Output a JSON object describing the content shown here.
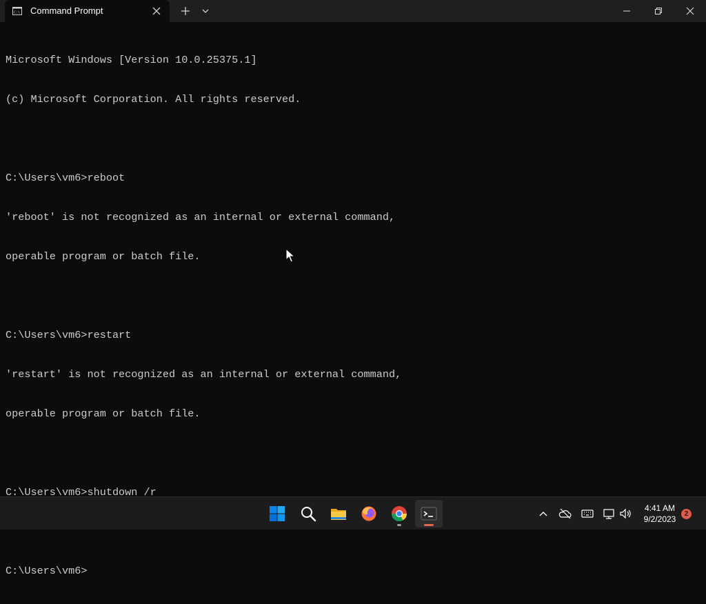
{
  "window": {
    "tab_title": "Command Prompt"
  },
  "console": {
    "lines": [
      "Microsoft Windows [Version 10.0.25375.1]",
      "(c) Microsoft Corporation. All rights reserved.",
      "",
      "C:\\Users\\vm6>reboot",
      "'reboot' is not recognized as an internal or external command,",
      "operable program or batch file.",
      "",
      "C:\\Users\\vm6>restart",
      "'restart' is not recognized as an internal or external command,",
      "operable program or batch file.",
      "",
      "C:\\Users\\vm6>shutdown /r",
      "",
      "C:\\Users\\vm6>"
    ]
  },
  "taskbar": {
    "pinned": [
      {
        "name": "start-button",
        "icon": "windows-logo-icon"
      },
      {
        "name": "search-button",
        "icon": "search-icon"
      },
      {
        "name": "file-explorer-button",
        "icon": "folder-icon"
      },
      {
        "name": "firefox-button",
        "icon": "firefox-icon"
      },
      {
        "name": "chrome-button",
        "icon": "chrome-icon"
      },
      {
        "name": "terminal-button",
        "icon": "terminal-icon"
      }
    ],
    "tray": {
      "time": "4:41 AM",
      "date": "9/2/2023",
      "notification_count": "2"
    }
  },
  "colors": {
    "console_bg": "#0c0c0c",
    "console_fg": "#cccccc",
    "titlebar_bg": "#1f1f1f",
    "taskbar_bg": "#1c1c1c",
    "active_indicator": "#e0684b",
    "notification_badge": "#e05a4a"
  }
}
